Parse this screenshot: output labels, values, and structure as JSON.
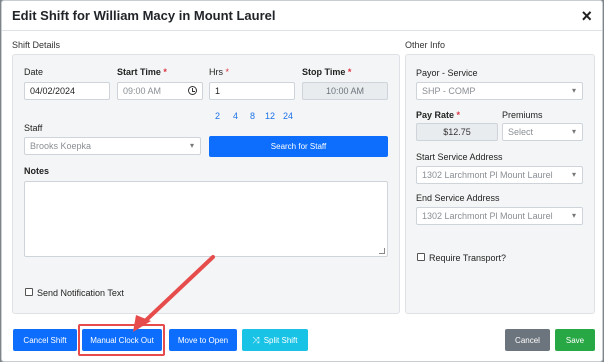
{
  "modal": {
    "title": "Edit Shift for William Macy in Mount Laurel",
    "close_glyph": "×"
  },
  "shift_details": {
    "section_label": "Shift Details",
    "date_label": "Date",
    "date_value": "04/02/2024",
    "start_time_label": "Start Time",
    "start_time_placeholder": "09:00 AM",
    "hrs_label": "Hrs",
    "hrs_value": "1",
    "stop_time_label": "Stop Time",
    "stop_time_value": "10:00 AM",
    "required_marker": "*",
    "hour_options": [
      "2",
      "4",
      "8",
      "12",
      "24"
    ],
    "staff_label": "Staff",
    "staff_value": "Brooks Koepka",
    "search_staff_button": "Search for Staff",
    "notes_label": "Notes",
    "notes_value": "",
    "send_notification_label": "Send Notification Text"
  },
  "other_info": {
    "section_label": "Other Info",
    "payor_label": "Payor - Service",
    "payor_value": "SHP - COMP",
    "pay_rate_label": "Pay Rate",
    "pay_rate_value": "$12.75",
    "premiums_label": "Premiums",
    "premiums_placeholder": "Select",
    "start_address_label": "Start Service Address",
    "start_address_value": "1302 Larchmont Pl Mount Laurel",
    "end_address_label": "End Service Address",
    "end_address_value": "1302 Larchmont Pl Mount Laurel",
    "require_transport_label": "Require Transport?"
  },
  "footer": {
    "cancel_shift": "Cancel Shift",
    "manual_clock_out": "Manual Clock Out",
    "move_to_open": "Move to Open",
    "split_shift": "Split Shift",
    "cancel": "Cancel",
    "save": "Save"
  },
  "icons": {
    "caret": "▾",
    "split": "⤨"
  },
  "colors": {
    "primary": "#0d6efd",
    "cyan": "#19c3e6",
    "gray": "#6c757d",
    "green": "#28a745",
    "highlight": "#e74c4c"
  }
}
